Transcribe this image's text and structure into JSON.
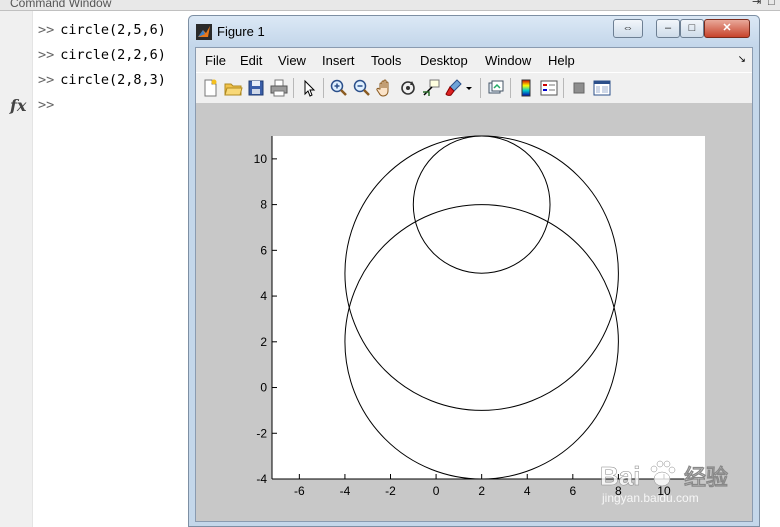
{
  "command_window": {
    "title": "Command Window",
    "prompt": ">>",
    "lines": [
      "circle(2,5,6)",
      "circle(2,2,6)",
      "circle(2,8,3)",
      ""
    ]
  },
  "figure": {
    "title": "Figure 1",
    "menu": [
      "File",
      "Edit",
      "View",
      "Insert",
      "Tools",
      "Desktop",
      "Window",
      "Help"
    ],
    "menu_overflow": "↘",
    "toolbar_icons": [
      "new-figure-icon",
      "open-file-icon",
      "save-icon",
      "print-icon",
      "pointer-icon",
      "zoom-in-icon",
      "zoom-out-icon",
      "pan-icon",
      "rotate-icon",
      "data-cursor-icon",
      "brush-icon",
      "link-plot-icon",
      "colorbar-icon",
      "legend-icon",
      "hide-plot-tools-icon",
      "show-plot-tools-icon"
    ],
    "window_buttons": {
      "restore": "⇔",
      "minimize": "–",
      "maximize": "□",
      "close": "✕"
    }
  },
  "chart_data": {
    "type": "line",
    "title": "",
    "xlabel": "",
    "ylabel": "",
    "xlim": [
      -7.2,
      11.8
    ],
    "ylim": [
      -4,
      11
    ],
    "xticks": [
      -6,
      -4,
      -2,
      0,
      2,
      4,
      6,
      8,
      10
    ],
    "yticks": [
      -4,
      -2,
      0,
      2,
      4,
      6,
      8,
      10
    ],
    "grid": false,
    "line_color": "#000000",
    "series": [
      {
        "cx": 2,
        "cy": 5,
        "r": 6
      },
      {
        "cx": 2,
        "cy": 2,
        "r": 6
      },
      {
        "cx": 2,
        "cy": 8,
        "r": 3
      }
    ]
  },
  "watermark": {
    "brand": "Bai",
    "brand_suffix": "经验",
    "url": "jingyan.baidu.com"
  }
}
